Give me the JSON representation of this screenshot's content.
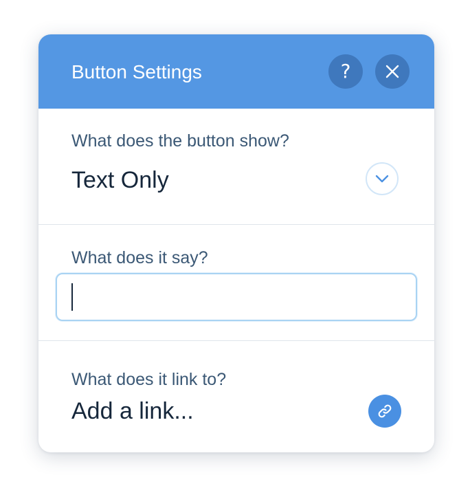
{
  "header": {
    "title": "Button Settings",
    "help_glyph": "?",
    "help_icon": "question-mark-icon",
    "close_icon": "close-icon"
  },
  "button_content": {
    "label": "What does the button show?",
    "selected": "Text Only",
    "dropdown_icon": "chevron-down-icon"
  },
  "button_text": {
    "label": "What does it say?",
    "value": "",
    "placeholder": ""
  },
  "button_link": {
    "label": "What does it link to?",
    "value": "Add a link...",
    "link_icon": "link-icon"
  },
  "colors": {
    "header_background": "#5497e3",
    "header_button": "#3f78bd",
    "link_button": "#4a90e2",
    "input_focus_border": "#a9d3f3"
  }
}
